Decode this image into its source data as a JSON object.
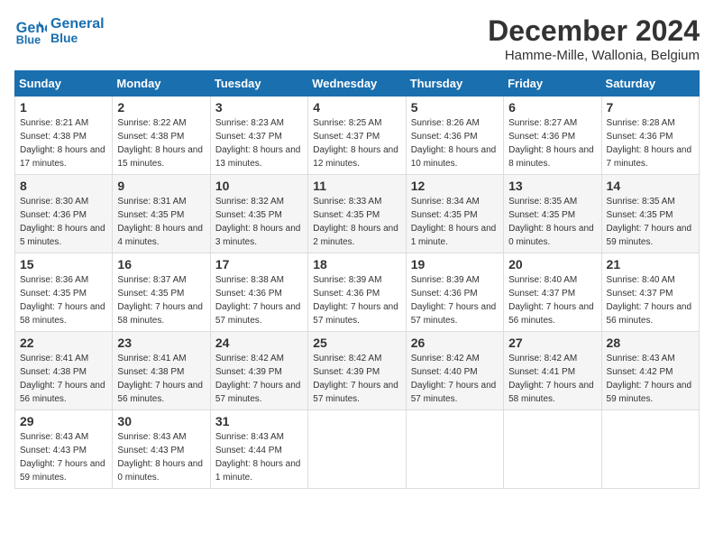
{
  "header": {
    "logo_line1": "General",
    "logo_line2": "Blue",
    "month": "December 2024",
    "location": "Hamme-Mille, Wallonia, Belgium"
  },
  "weekdays": [
    "Sunday",
    "Monday",
    "Tuesday",
    "Wednesday",
    "Thursday",
    "Friday",
    "Saturday"
  ],
  "weeks": [
    [
      {
        "day": "1",
        "sunrise": "8:21 AM",
        "sunset": "4:38 PM",
        "daylight": "8 hours and 17 minutes."
      },
      {
        "day": "2",
        "sunrise": "8:22 AM",
        "sunset": "4:38 PM",
        "daylight": "8 hours and 15 minutes."
      },
      {
        "day": "3",
        "sunrise": "8:23 AM",
        "sunset": "4:37 PM",
        "daylight": "8 hours and 13 minutes."
      },
      {
        "day": "4",
        "sunrise": "8:25 AM",
        "sunset": "4:37 PM",
        "daylight": "8 hours and 12 minutes."
      },
      {
        "day": "5",
        "sunrise": "8:26 AM",
        "sunset": "4:36 PM",
        "daylight": "8 hours and 10 minutes."
      },
      {
        "day": "6",
        "sunrise": "8:27 AM",
        "sunset": "4:36 PM",
        "daylight": "8 hours and 8 minutes."
      },
      {
        "day": "7",
        "sunrise": "8:28 AM",
        "sunset": "4:36 PM",
        "daylight": "8 hours and 7 minutes."
      }
    ],
    [
      {
        "day": "8",
        "sunrise": "8:30 AM",
        "sunset": "4:36 PM",
        "daylight": "8 hours and 5 minutes."
      },
      {
        "day": "9",
        "sunrise": "8:31 AM",
        "sunset": "4:35 PM",
        "daylight": "8 hours and 4 minutes."
      },
      {
        "day": "10",
        "sunrise": "8:32 AM",
        "sunset": "4:35 PM",
        "daylight": "8 hours and 3 minutes."
      },
      {
        "day": "11",
        "sunrise": "8:33 AM",
        "sunset": "4:35 PM",
        "daylight": "8 hours and 2 minutes."
      },
      {
        "day": "12",
        "sunrise": "8:34 AM",
        "sunset": "4:35 PM",
        "daylight": "8 hours and 1 minute."
      },
      {
        "day": "13",
        "sunrise": "8:35 AM",
        "sunset": "4:35 PM",
        "daylight": "8 hours and 0 minutes."
      },
      {
        "day": "14",
        "sunrise": "8:35 AM",
        "sunset": "4:35 PM",
        "daylight": "7 hours and 59 minutes."
      }
    ],
    [
      {
        "day": "15",
        "sunrise": "8:36 AM",
        "sunset": "4:35 PM",
        "daylight": "7 hours and 58 minutes."
      },
      {
        "day": "16",
        "sunrise": "8:37 AM",
        "sunset": "4:35 PM",
        "daylight": "7 hours and 58 minutes."
      },
      {
        "day": "17",
        "sunrise": "8:38 AM",
        "sunset": "4:36 PM",
        "daylight": "7 hours and 57 minutes."
      },
      {
        "day": "18",
        "sunrise": "8:39 AM",
        "sunset": "4:36 PM",
        "daylight": "7 hours and 57 minutes."
      },
      {
        "day": "19",
        "sunrise": "8:39 AM",
        "sunset": "4:36 PM",
        "daylight": "7 hours and 57 minutes."
      },
      {
        "day": "20",
        "sunrise": "8:40 AM",
        "sunset": "4:37 PM",
        "daylight": "7 hours and 56 minutes."
      },
      {
        "day": "21",
        "sunrise": "8:40 AM",
        "sunset": "4:37 PM",
        "daylight": "7 hours and 56 minutes."
      }
    ],
    [
      {
        "day": "22",
        "sunrise": "8:41 AM",
        "sunset": "4:38 PM",
        "daylight": "7 hours and 56 minutes."
      },
      {
        "day": "23",
        "sunrise": "8:41 AM",
        "sunset": "4:38 PM",
        "daylight": "7 hours and 56 minutes."
      },
      {
        "day": "24",
        "sunrise": "8:42 AM",
        "sunset": "4:39 PM",
        "daylight": "7 hours and 57 minutes."
      },
      {
        "day": "25",
        "sunrise": "8:42 AM",
        "sunset": "4:39 PM",
        "daylight": "7 hours and 57 minutes."
      },
      {
        "day": "26",
        "sunrise": "8:42 AM",
        "sunset": "4:40 PM",
        "daylight": "7 hours and 57 minutes."
      },
      {
        "day": "27",
        "sunrise": "8:42 AM",
        "sunset": "4:41 PM",
        "daylight": "7 hours and 58 minutes."
      },
      {
        "day": "28",
        "sunrise": "8:43 AM",
        "sunset": "4:42 PM",
        "daylight": "7 hours and 59 minutes."
      }
    ],
    [
      {
        "day": "29",
        "sunrise": "8:43 AM",
        "sunset": "4:43 PM",
        "daylight": "7 hours and 59 minutes."
      },
      {
        "day": "30",
        "sunrise": "8:43 AM",
        "sunset": "4:43 PM",
        "daylight": "8 hours and 0 minutes."
      },
      {
        "day": "31",
        "sunrise": "8:43 AM",
        "sunset": "4:44 PM",
        "daylight": "8 hours and 1 minute."
      },
      null,
      null,
      null,
      null
    ]
  ]
}
